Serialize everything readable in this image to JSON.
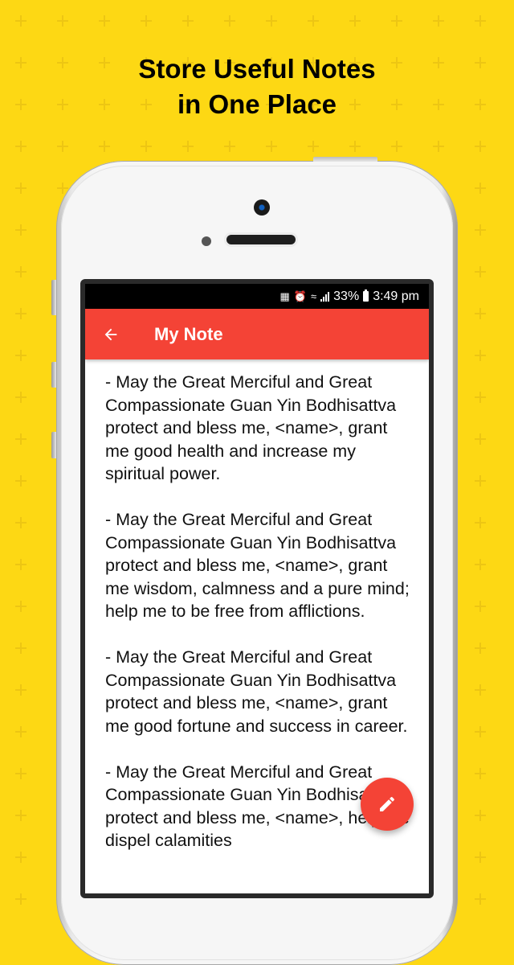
{
  "promo": {
    "headline_line1": "Store Useful Notes",
    "headline_line2": "in One Place",
    "background_color": "#FDD814"
  },
  "status_bar": {
    "icons": [
      "battery-saver-icon",
      "alarm-icon",
      "wifi-icon",
      "signal-icon"
    ],
    "battery_percent": "33%",
    "time": "3:49 pm"
  },
  "app_bar": {
    "back_icon": "arrow-left-icon",
    "title": "My Note",
    "color": "#F44336"
  },
  "note": {
    "paragraphs": [
      "- May the Great Merciful and Great Compassionate Guan Yin Bodhisattva protect and bless me, <name>, grant me good health and increase my spiritual power.",
      "- May the Great Merciful and Great Compassionate Guan Yin Bodhisattva protect and bless me, <name>, grant me wisdom, calmness and a pure mind; help me to be free from afflictions.",
      "- May the Great Merciful and Great Compassionate Guan Yin Bodhisattva protect and bless me, <name>, grant me good fortune and success in career.",
      "- May the Great Merciful and Great Compassionate Guan Yin Bodhisattva protect and bless me, <name>, help me dispel calamities"
    ]
  },
  "fab": {
    "icon": "pencil-icon",
    "label": "Edit note"
  }
}
